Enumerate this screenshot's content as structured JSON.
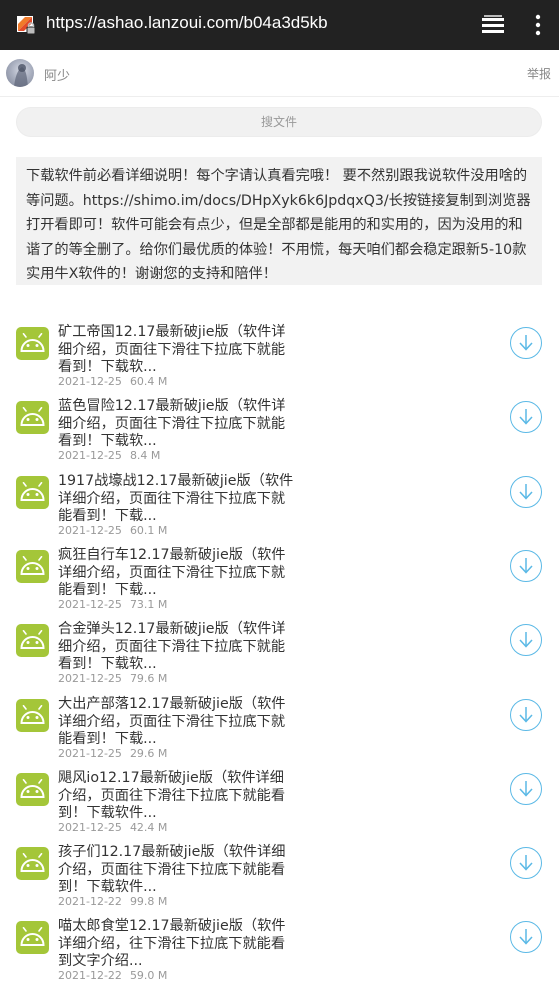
{
  "browser": {
    "url": "https://ashao.lanzoui.com/b04a3d5kb",
    "icons": [
      "site-icon",
      "tabs-icon",
      "more-vert-icon"
    ]
  },
  "header": {
    "username": "阿少",
    "report": "举报"
  },
  "search": {
    "label": "搜文件"
  },
  "description": "下载软件前必看详细说明！每个字请认真看完哦！ 要不然别跟我说软件没用啥的等问题。https://shimo.im/docs/DHpXyk6k6JpdqxQ3/长按链接复制到浏览器打开看即可！软件可能会有点少，但是全部都是能用的和实用的，因为没用的和谐了的等全删了。给你们最优质的体验！不用慌，每天咱们都会稳定跟新5-10款实用牛X软件的！谢谢您的支持和陪伴！",
  "colors": {
    "accent": "#5bb9e6",
    "android_green": "#a4c639",
    "urlbar": "#222222"
  },
  "files": [
    {
      "name": "矿工帝国12.17最新破jie版（软件详细介绍，页面往下滑往下拉底下就能看到！下载软...",
      "date": "2021-12-25",
      "size": "60.4 M"
    },
    {
      "name": "蓝色冒险12.17最新破jie版（软件详细介绍，页面往下滑往下拉底下就能看到！下载软...",
      "date": "2021-12-25",
      "size": "8.4 M"
    },
    {
      "name": "1917战壕战12.17最新破jie版（软件详细介绍，页面往下滑往下拉底下就能看到！下载...",
      "date": "2021-12-25",
      "size": "60.1 M"
    },
    {
      "name": "疯狂自行车12.17最新破jie版（软件详细介绍，页面往下滑往下拉底下就能看到！下载...",
      "date": "2021-12-25",
      "size": "73.1 M"
    },
    {
      "name": "合金弹头12.17最新破jie版（软件详细介绍，页面往下滑往下拉底下就能看到！下载软...",
      "date": "2021-12-25",
      "size": "79.6 M"
    },
    {
      "name": "大出产部落12.17最新破jie版（软件详细介绍，页面往下滑往下拉底下就能看到！下载...",
      "date": "2021-12-25",
      "size": "29.6 M"
    },
    {
      "name": "飓风io12.17最新破jie版（软件详细介绍，页面往下滑往下拉底下就能看到！下载软件...",
      "date": "2021-12-25",
      "size": "42.4 M"
    },
    {
      "name": "孩子们12.17最新破jie版（软件详细介绍，页面往下滑往下拉底下就能看到！下载软件...",
      "date": "2021-12-22",
      "size": "99.8 M"
    },
    {
      "name": "喵太郎食堂12.17最新破jie版（软件详细介绍，往下滑往下拉底下就能看到文字介绍...",
      "date": "2021-12-22",
      "size": "59.0 M"
    }
  ]
}
